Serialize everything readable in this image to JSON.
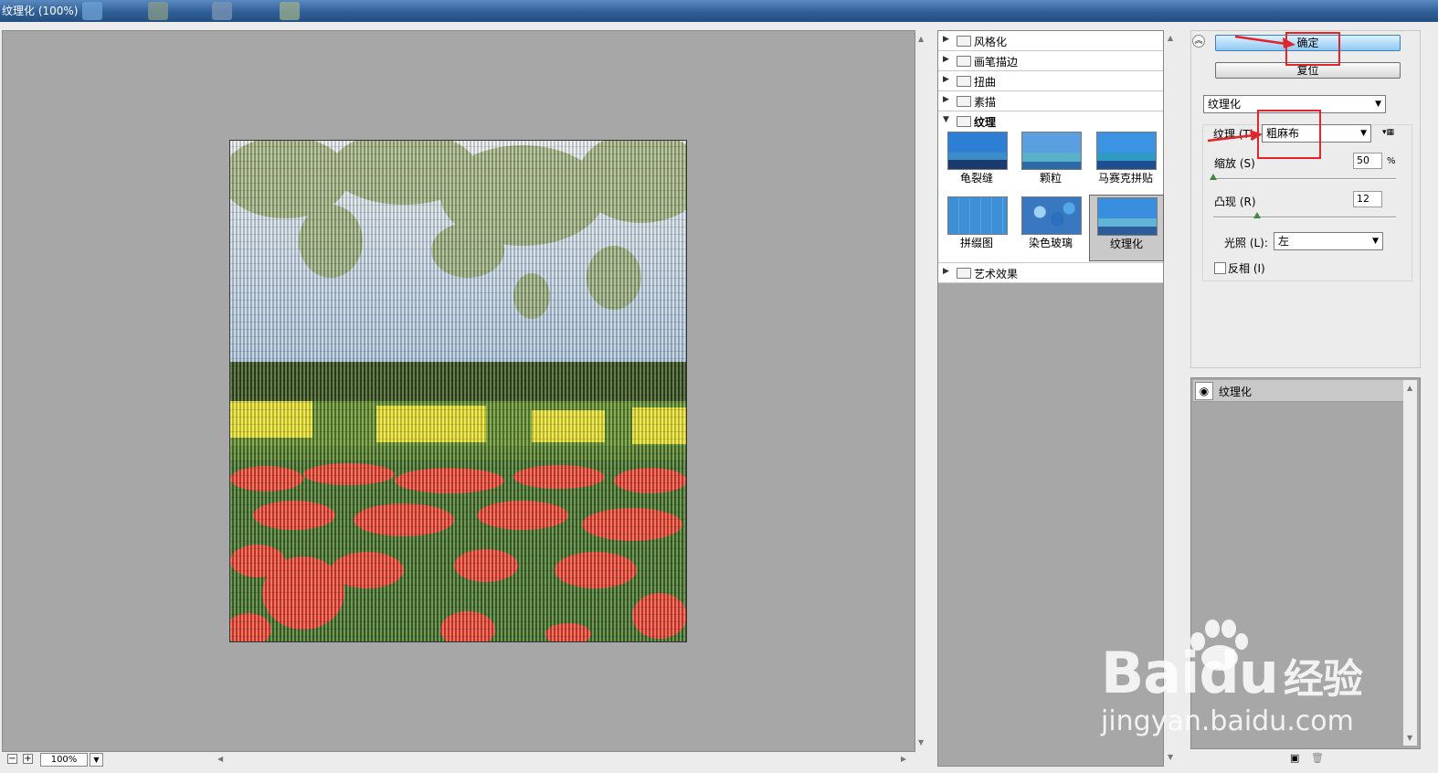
{
  "window": {
    "title": "纹理化 (100%)"
  },
  "preview": {
    "zoom": "100%",
    "zoom_out_label": "−",
    "zoom_in_label": "+"
  },
  "gallery": {
    "categories": [
      {
        "label": "风格化",
        "expanded": false
      },
      {
        "label": "画笔描边",
        "expanded": false
      },
      {
        "label": "扭曲",
        "expanded": false
      },
      {
        "label": "素描",
        "expanded": false
      },
      {
        "label": "纹理",
        "expanded": true
      },
      {
        "label": "艺术效果",
        "expanded": false
      }
    ],
    "texture_filters": [
      {
        "label": "龟裂缝",
        "selected": false
      },
      {
        "label": "颗粒",
        "selected": false
      },
      {
        "label": "马赛克拼贴",
        "selected": false
      },
      {
        "label": "拼缀图",
        "selected": false
      },
      {
        "label": "染色玻璃",
        "selected": false
      },
      {
        "label": "纹理化",
        "selected": true
      }
    ]
  },
  "settings": {
    "ok_label": "确定",
    "reset_label": "复位",
    "filter_select": "纹理化",
    "texture_label": "纹理 (T)",
    "texture_value": "粗麻布",
    "scale_label": "缩放 (S)",
    "scale_value": "50",
    "scale_unit": "%",
    "scale_fraction": 0.0,
    "relief_label": "凸现 (R)",
    "relief_value": "12",
    "relief_max": 50,
    "light_label": "光照 (L):",
    "light_value": "左",
    "invert_label": "反相 (I)",
    "invert_checked": false
  },
  "layers": [
    {
      "label": "纹理化",
      "visible": true
    }
  ],
  "watermark": {
    "brand": "Bai",
    "brand2": "du",
    "brand_cn": "经验",
    "url": "jingyan.baidu.com"
  },
  "colors": {
    "canvas_gray": "#a7a7a7",
    "annotation_red": "#e0262a",
    "ok_blue": "#8ec9f5"
  }
}
